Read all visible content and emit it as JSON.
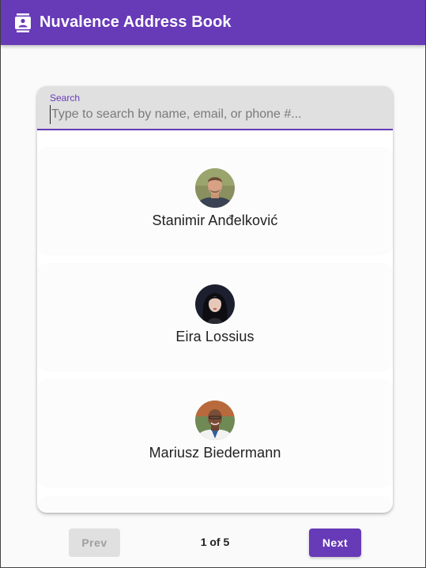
{
  "app": {
    "title": "Nuvalence Address Book",
    "icon": "contact-book-icon",
    "accent_color": "#673ab7"
  },
  "search": {
    "label": "Search",
    "value": "",
    "placeholder": "Type to search by name, email, or phone #..."
  },
  "contacts": [
    {
      "name": "Stanimir Anđelković",
      "avatar": "avatar-photo"
    },
    {
      "name": "Eira Lossius",
      "avatar": "avatar-photo"
    },
    {
      "name": "Mariusz Biedermann",
      "avatar": "avatar-photo"
    }
  ],
  "pagination": {
    "prev_label": "Prev",
    "next_label": "Next",
    "page_text": "1 of 5",
    "prev_disabled": true
  }
}
